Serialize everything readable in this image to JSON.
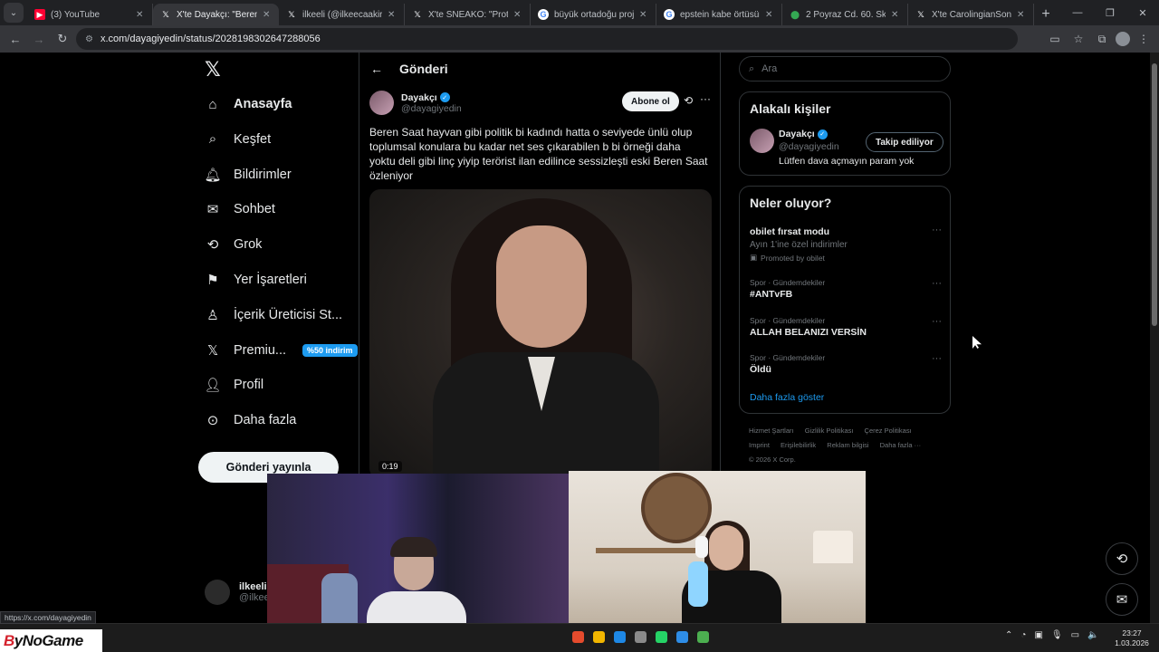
{
  "browser": {
    "tabs": [
      {
        "title": "(3) YouTube",
        "icon": "youtube-icon",
        "active": false
      },
      {
        "title": "X'te Dayakçı: \"Beren Saat",
        "icon": "x-icon",
        "active": true
      },
      {
        "title": "ilkeeli (@ilkeecaakir) / X",
        "icon": "x-icon",
        "active": false
      },
      {
        "title": "X'te SNEAKO: \"Protect Tu",
        "icon": "x-icon",
        "active": false
      },
      {
        "title": "büyük ortadoğu projesi h",
        "icon": "google-icon",
        "active": false
      },
      {
        "title": "epstein kabe örtüsünü ki",
        "icon": "google-icon",
        "active": false
      },
      {
        "title": "2 Poyraz Cd. 60. Sk. - Goo",
        "icon": "maps-icon",
        "active": false
      },
      {
        "title": "X'te CarolingianSon: \"@E",
        "icon": "x-icon",
        "active": false
      }
    ],
    "url": "x.com/dayagiyedin/status/2028198302647288056",
    "status_url": "https://x.com/dayagiyedin"
  },
  "leftnav": {
    "items": [
      {
        "label": "Anasayfa",
        "icon": "home-icon",
        "bold": true
      },
      {
        "label": "Keşfet",
        "icon": "search-icon"
      },
      {
        "label": "Bildirimler",
        "icon": "bell-icon"
      },
      {
        "label": "Sohbet",
        "icon": "mail-icon"
      },
      {
        "label": "Grok",
        "icon": "grok-icon"
      },
      {
        "label": "Yer İşaretleri",
        "icon": "bookmark-icon"
      },
      {
        "label": "İçerik Üreticisi St...",
        "icon": "creator-icon"
      },
      {
        "label": "Premiu...",
        "icon": "x-premium-icon"
      },
      {
        "label": "Profil",
        "icon": "person-icon"
      },
      {
        "label": "Daha fazla",
        "icon": "more-circle-icon"
      }
    ],
    "premium_badge": "%50 indirim",
    "post_button": "Gönderi yayınla",
    "account": {
      "name": "ilkeeli",
      "handle": "@ilkeec"
    }
  },
  "post": {
    "header_title": "Gönderi",
    "author_name": "Dayakçı",
    "author_handle": "@dayagiyedin",
    "follow_label": "Abone ol",
    "text": "Beren Saat hayvan gibi politik bi kadındı hatta o seviyede ünlü olup toplumsal konulara bu kadar net ses çıkarabilen b bi örneği daha yoktu deli gibi linç yiyip terörist ilan edilince sessizleşti eski Beren Saat özleniyor",
    "video_time": "0:19"
  },
  "right": {
    "search_placeholder": "Ara",
    "related": {
      "heading": "Alakalı kişiler",
      "name": "Dayakçı",
      "handle": "@dayagiyedin",
      "bio": "Lütfen dava açmayın param yok",
      "button": "Takip ediliyor"
    },
    "trends": {
      "heading": "Neler oluyor?",
      "items": [
        {
          "title": "obilet fırsat modu",
          "subtitle": "Ayın 1'ine özel indirimler",
          "promo": "Promoted by obilet"
        },
        {
          "context": "Spor · Gündemdekiler",
          "title": "#ANTvFB"
        },
        {
          "context": "Spor · Gündemdekiler",
          "title": "ALLAH BELANIZI VERSİN"
        },
        {
          "context": "Spor · Gündemdekiler",
          "title": "Öldü"
        }
      ],
      "show_more": "Daha fazla göster"
    },
    "footer": [
      "Hizmet Şartları",
      "Gizlilik Politikası",
      "Çerez Politikası",
      "Imprint",
      "Erişilebilirlik",
      "Reklam bilgisi",
      "Daha fazla ···",
      "© 2026 X Corp."
    ]
  },
  "watermark": {
    "prefix": "B",
    "text": "yNoGame"
  },
  "clock": {
    "time": "23:27",
    "date": "1.03.2026"
  },
  "colors": {
    "accent": "#1d9bf0",
    "background": "#000000",
    "chrome": "#202124"
  }
}
